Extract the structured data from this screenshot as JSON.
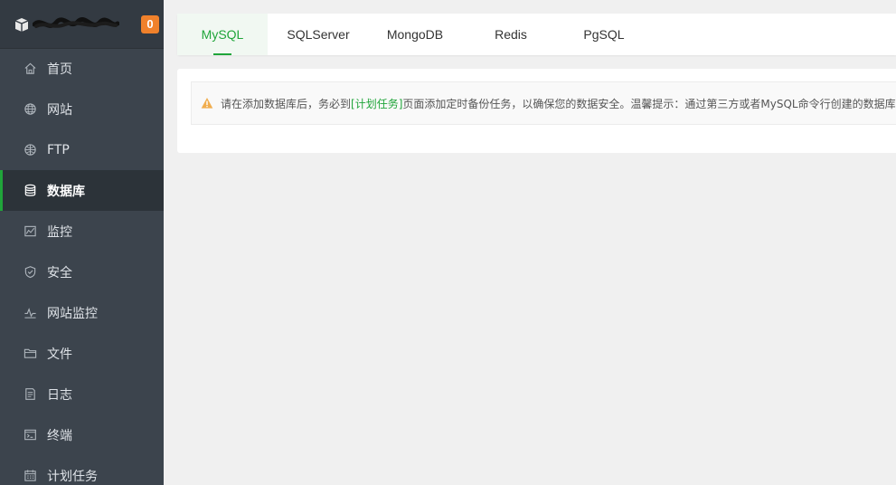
{
  "sidebar": {
    "badge": "0",
    "items": [
      {
        "label": "首页",
        "icon": "home-icon"
      },
      {
        "label": "网站",
        "icon": "globe-icon"
      },
      {
        "label": "FTP",
        "icon": "ftp-icon"
      },
      {
        "label": "数据库",
        "icon": "database-icon"
      },
      {
        "label": "监控",
        "icon": "monitor-icon"
      },
      {
        "label": "安全",
        "icon": "shield-icon"
      },
      {
        "label": "网站监控",
        "icon": "pulse-icon"
      },
      {
        "label": "文件",
        "icon": "folder-icon"
      },
      {
        "label": "日志",
        "icon": "log-icon"
      },
      {
        "label": "终端",
        "icon": "terminal-icon"
      },
      {
        "label": "计划任务",
        "icon": "calendar-icon"
      }
    ],
    "active_index": 3
  },
  "tabs": {
    "items": [
      "MySQL",
      "SQLServer",
      "MongoDB",
      "Redis",
      "PgSQL"
    ],
    "active_index": 0
  },
  "notice": {
    "icon": "warning-icon",
    "text_before": "请在添加数据库后，务必到",
    "link_text": "[计划任务]",
    "text_after": "页面添加定时备份任务，以确保您的数据安全。温馨提示：通过第三方或者MySQL命令行创建的数据库"
  },
  "colors": {
    "accent": "#20a53a",
    "sidebar_bg": "#3c444d",
    "badge": "#f0812b",
    "warning": "#f0ad4e"
  }
}
